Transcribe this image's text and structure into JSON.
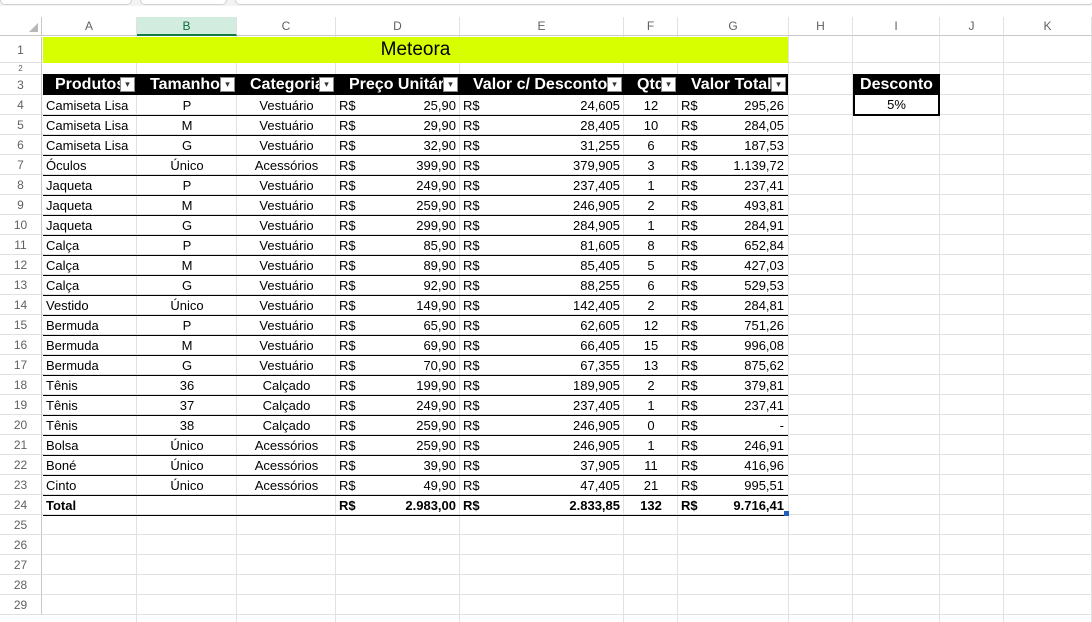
{
  "columns": [
    "A",
    "B",
    "C",
    "D",
    "E",
    "F",
    "G",
    "H",
    "I",
    "J",
    "K"
  ],
  "rows": [
    "1",
    "2",
    "3",
    "4",
    "5",
    "6",
    "7",
    "8",
    "9",
    "10",
    "11",
    "12",
    "13",
    "14",
    "15",
    "16",
    "17",
    "18",
    "19",
    "20",
    "21",
    "22",
    "23",
    "24",
    "25",
    "26",
    "27",
    "28",
    "29"
  ],
  "title": "Meteora",
  "headers": [
    "Produtos",
    "Tamanho",
    "Categoria",
    "Preço Unitário",
    "Valor c/ Desconto",
    "Qtd",
    "Valor Total"
  ],
  "currency": "R$",
  "products": [
    {
      "produto": "Camiseta Lisa",
      "tamanho": "P",
      "categoria": "Vestuário",
      "preco": "25,90",
      "desconto": "24,605",
      "qtd": "12",
      "total": "295,26"
    },
    {
      "produto": "Camiseta Lisa",
      "tamanho": "M",
      "categoria": "Vestuário",
      "preco": "29,90",
      "desconto": "28,405",
      "qtd": "10",
      "total": "284,05"
    },
    {
      "produto": "Camiseta Lisa",
      "tamanho": "G",
      "categoria": "Vestuário",
      "preco": "32,90",
      "desconto": "31,255",
      "qtd": "6",
      "total": "187,53"
    },
    {
      "produto": "Óculos",
      "tamanho": "Único",
      "categoria": "Acessórios",
      "preco": "399,90",
      "desconto": "379,905",
      "qtd": "3",
      "total": "1.139,72"
    },
    {
      "produto": "Jaqueta",
      "tamanho": "P",
      "categoria": "Vestuário",
      "preco": "249,90",
      "desconto": "237,405",
      "qtd": "1",
      "total": "237,41"
    },
    {
      "produto": "Jaqueta",
      "tamanho": "M",
      "categoria": "Vestuário",
      "preco": "259,90",
      "desconto": "246,905",
      "qtd": "2",
      "total": "493,81"
    },
    {
      "produto": "Jaqueta",
      "tamanho": "G",
      "categoria": "Vestuário",
      "preco": "299,90",
      "desconto": "284,905",
      "qtd": "1",
      "total": "284,91"
    },
    {
      "produto": "Calça",
      "tamanho": "P",
      "categoria": "Vestuário",
      "preco": "85,90",
      "desconto": "81,605",
      "qtd": "8",
      "total": "652,84"
    },
    {
      "produto": "Calça",
      "tamanho": "M",
      "categoria": "Vestuário",
      "preco": "89,90",
      "desconto": "85,405",
      "qtd": "5",
      "total": "427,03"
    },
    {
      "produto": "Calça",
      "tamanho": "G",
      "categoria": "Vestuário",
      "preco": "92,90",
      "desconto": "88,255",
      "qtd": "6",
      "total": "529,53"
    },
    {
      "produto": "Vestido",
      "tamanho": "Único",
      "categoria": "Vestuário",
      "preco": "149,90",
      "desconto": "142,405",
      "qtd": "2",
      "total": "284,81"
    },
    {
      "produto": "Bermuda",
      "tamanho": "P",
      "categoria": "Vestuário",
      "preco": "65,90",
      "desconto": "62,605",
      "qtd": "12",
      "total": "751,26"
    },
    {
      "produto": "Bermuda",
      "tamanho": "M",
      "categoria": "Vestuário",
      "preco": "69,90",
      "desconto": "66,405",
      "qtd": "15",
      "total": "996,08"
    },
    {
      "produto": "Bermuda",
      "tamanho": "G",
      "categoria": "Vestuário",
      "preco": "70,90",
      "desconto": "67,355",
      "qtd": "13",
      "total": "875,62"
    },
    {
      "produto": "Tênis",
      "tamanho": "36",
      "categoria": "Calçado",
      "preco": "199,90",
      "desconto": "189,905",
      "qtd": "2",
      "total": "379,81"
    },
    {
      "produto": "Tênis",
      "tamanho": "37",
      "categoria": "Calçado",
      "preco": "249,90",
      "desconto": "237,405",
      "qtd": "1",
      "total": "237,41"
    },
    {
      "produto": "Tênis",
      "tamanho": "38",
      "categoria": "Calçado",
      "preco": "259,90",
      "desconto": "246,905",
      "qtd": "0",
      "total": "-"
    },
    {
      "produto": "Bolsa",
      "tamanho": "Único",
      "categoria": "Acessórios",
      "preco": "259,90",
      "desconto": "246,905",
      "qtd": "1",
      "total": "246,91"
    },
    {
      "produto": "Boné",
      "tamanho": "Único",
      "categoria": "Acessórios",
      "preco": "39,90",
      "desconto": "37,905",
      "qtd": "11",
      "total": "416,96"
    },
    {
      "produto": "Cinto",
      "tamanho": "Único",
      "categoria": "Acessórios",
      "preco": "49,90",
      "desconto": "47,405",
      "qtd": "21",
      "total": "995,51"
    }
  ],
  "totals": {
    "label": "Total",
    "preco": "2.983,00",
    "desconto": "2.833,85",
    "qtd": "132",
    "total": "9.716,41"
  },
  "discount": {
    "label": "Desconto",
    "value": "5%"
  },
  "colors": {
    "title_bg": "#d7ff00",
    "header_bg": "#000000",
    "selected_col": "#d3ece0"
  }
}
